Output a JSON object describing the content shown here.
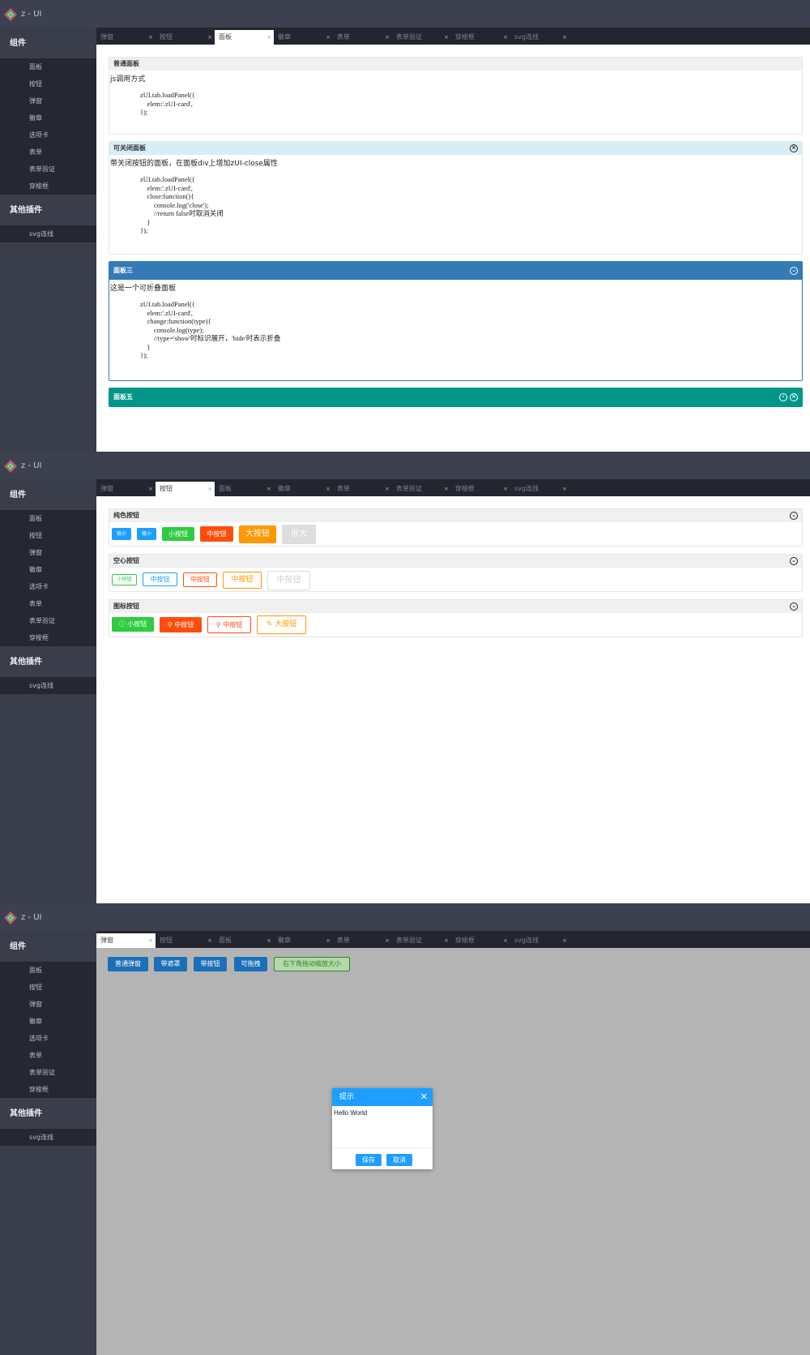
{
  "app": {
    "title": "z - UI"
  },
  "sidebar": {
    "group1": "组件",
    "items": [
      "面板",
      "按钮",
      "弹窗",
      "徽章",
      "选项卡",
      "表单",
      "表单验证",
      "穿梭框"
    ],
    "group2": "其他插件",
    "plugins": [
      "svg连线"
    ]
  },
  "tabs_close": "×",
  "screen1": {
    "tabs": [
      "弹窗",
      "按钮",
      "面板",
      "徽章",
      "表单",
      "表单验证",
      "穿梭框",
      "svg连线"
    ],
    "active_tab": "面板",
    "panels": [
      {
        "title": "普通面板",
        "desc": "js调用方式",
        "code": "zUI.tab.loadPanel({\n    elem:'.zUI-card',\n});"
      },
      {
        "title": "可关闭面板",
        "desc": "带关闭按钮的面板，在面板div上增加zUI-close属性",
        "code": "zUI.tab.loadPanel({\n    elem:'.zUI-card',\n    close:function(){\n        console.log('close');\n        //return false时取消关闭\n    }\n});"
      },
      {
        "title": "面板三",
        "desc": "这是一个可折叠面板",
        "code": "zUI.tab.loadPanel({\n    elem:'.zUI-card',\n    change:function(type){\n        console.log(type);\n        //type='show'时标识展开，'hide'时表示折叠\n    }\n});"
      },
      {
        "title": "面板五"
      }
    ]
  },
  "screen2": {
    "tabs": [
      "弹窗",
      "按钮",
      "面板",
      "徽章",
      "表单",
      "表单验证",
      "穿梭框",
      "svg连线"
    ],
    "active_tab": "按钮",
    "panels": [
      {
        "title": "纯色按钮",
        "buttons": [
          "极小",
          "极小",
          "小按钮",
          "中按钮",
          "大按钮",
          "很大"
        ]
      },
      {
        "title": "空心按钮",
        "buttons": [
          "小按钮",
          "中按钮",
          "中按钮",
          "中按钮",
          "中按钮"
        ]
      },
      {
        "title": "图标按钮",
        "buttons": [
          "小按钮",
          "中按钮",
          "中按钮",
          "大按钮"
        ]
      }
    ]
  },
  "screen3": {
    "tabs": [
      "弹窗",
      "按钮",
      "面板",
      "徽章",
      "表单",
      "表单验证",
      "穿梭框",
      "svg连线"
    ],
    "active_tab": "弹窗",
    "buttons": [
      "普通弹窗",
      "带遮罩",
      "带按钮",
      "可拖拽",
      "右下角拖动缩放大小"
    ],
    "dialog": {
      "title": "提示",
      "body": "Hello World",
      "ok": "保存",
      "cancel": "取消"
    }
  },
  "colors": {
    "blue": "#1e9fff",
    "green": "#2ecc40",
    "red": "#ff4d0d",
    "orange": "#ff9800",
    "gray": "#dddddd",
    "teal": "#009688",
    "panelBlue": "#337ab7"
  }
}
